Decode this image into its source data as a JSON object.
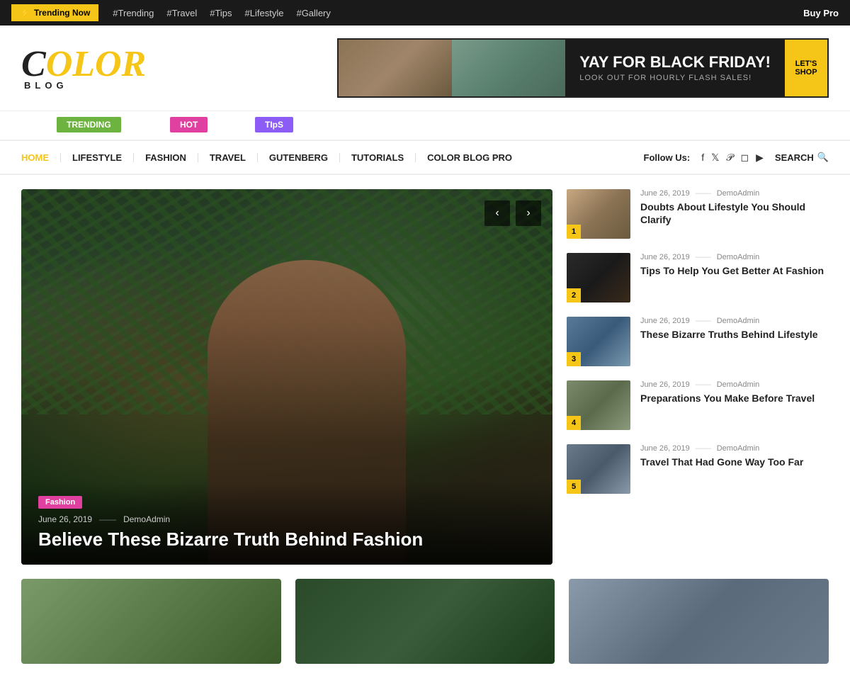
{
  "topbar": {
    "trending_label": "Trending Now",
    "bolt": "⚡",
    "links": [
      "#Trending",
      "#Travel",
      "#Tips",
      "#Lifestyle",
      "#Gallery"
    ],
    "buy_pro": "Buy Pro"
  },
  "header": {
    "logo_color": "COLOR",
    "logo_blog": "BLOG",
    "banner": {
      "headline": "YAY FOR BLACK FRIDAY!",
      "subtext": "LOOK OUT FOR HOURLY FLASH SALES!",
      "cta": "LET'S\nSHOP"
    }
  },
  "tags": {
    "trending": "TRENDING",
    "hot": "HOT",
    "tips": "TIpS"
  },
  "nav": {
    "links": [
      "HOME",
      "LIFESTYLE",
      "FASHION",
      "TRAVEL",
      "GUTENBERG",
      "TUTORIALS",
      "COLOR BLOG PRO"
    ],
    "follow_us": "Follow Us:",
    "search": "Search"
  },
  "featured": {
    "category": "Fashion",
    "date": "June 26, 2019",
    "author": "DemoAdmin",
    "title": "Believe These Bizarre Truth Behind Fashion"
  },
  "sidebar": {
    "items": [
      {
        "num": "1",
        "date": "June 26, 2019",
        "author": "DemoAdmin",
        "title": "Doubts About Lifestyle You Should Clarify",
        "thumb_class": "thumb-1"
      },
      {
        "num": "2",
        "date": "June 26, 2019",
        "author": "DemoAdmin",
        "title": "Tips To Help You Get Better At Fashion",
        "thumb_class": "thumb-2"
      },
      {
        "num": "3",
        "date": "June 26, 2019",
        "author": "DemoAdmin",
        "title": "These Bizarre Truths Behind Lifestyle",
        "thumb_class": "thumb-3"
      },
      {
        "num": "4",
        "date": "June 26, 2019",
        "author": "DemoAdmin",
        "title": "Preparations You Make Before Travel",
        "thumb_class": "thumb-4"
      },
      {
        "num": "5",
        "date": "June 26, 2019",
        "author": "DemoAdmin",
        "title": "Travel That Had Gone Way Too Far",
        "thumb_class": "thumb-5"
      }
    ]
  },
  "colors": {
    "accent_yellow": "#f5c518",
    "accent_pink": "#e040a0",
    "accent_green": "#6db33f",
    "accent_purple": "#8b5cf6",
    "dark": "#1a1a1a"
  }
}
